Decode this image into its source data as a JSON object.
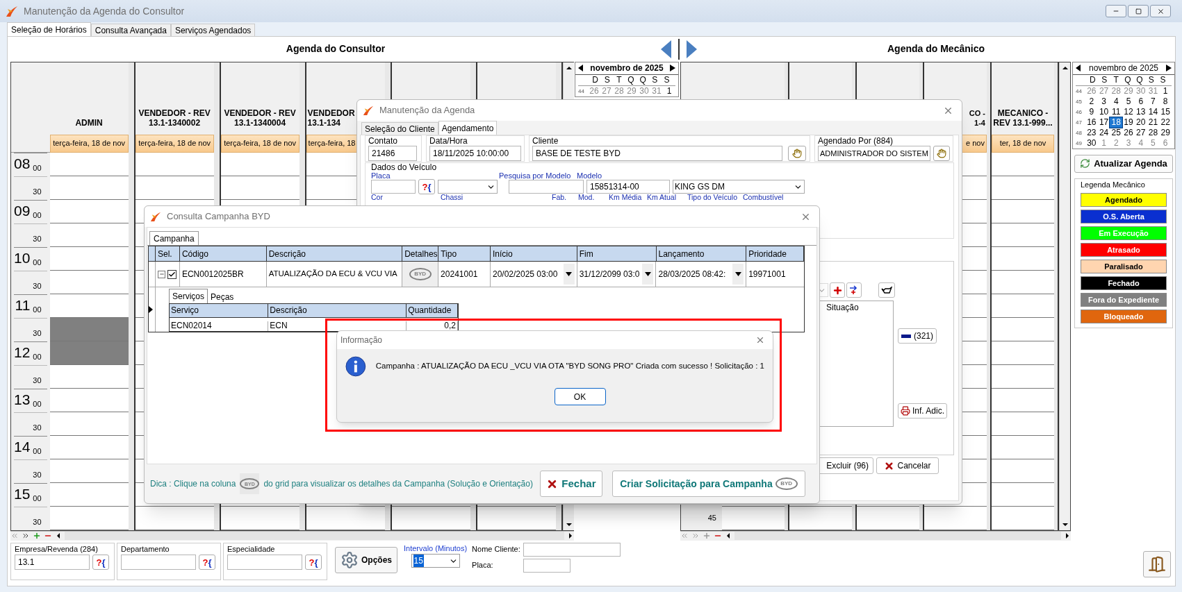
{
  "window": {
    "title": "Manutenção da Agenda do Consultor"
  },
  "tabs": [
    {
      "label": "Seleção de Horários",
      "selected": true
    },
    {
      "label": "Consulta Avançada",
      "selected": false
    },
    {
      "label": "Serviços Agendados",
      "selected": false
    }
  ],
  "consultor": {
    "title": "Agenda do Consultor",
    "time_rows": [
      {
        "hour": "08",
        "minute": "00"
      },
      {
        "minute": "30"
      },
      {
        "hour": "09",
        "minute": "00"
      },
      {
        "minute": "30"
      },
      {
        "hour": "10",
        "minute": "00"
      },
      {
        "minute": "30"
      },
      {
        "hour": "11",
        "minute": "00"
      },
      {
        "minute": "30"
      },
      {
        "hour": "12",
        "minute": "00"
      },
      {
        "minute": "30"
      },
      {
        "hour": "13",
        "minute": "00"
      },
      {
        "minute": "30"
      },
      {
        "hour": "14",
        "minute": "00"
      },
      {
        "minute": "30"
      },
      {
        "hour": "15",
        "minute": "00"
      },
      {
        "minute": "30"
      }
    ],
    "columns": [
      {
        "kind": "full",
        "name_lines": [
          "ADMIN"
        ],
        "date": "terça-feira, 18 de nov",
        "slots": [
          {
            "kind": "free"
          },
          {
            "kind": "free"
          },
          {
            "kind": "free"
          },
          {
            "kind": "free"
          },
          {
            "kind": "free"
          },
          {
            "kind": "free"
          },
          {
            "kind": "free"
          },
          {
            "kind": "blocked"
          },
          {
            "kind": "blocked"
          },
          {
            "kind": "free"
          },
          {
            "kind": "free"
          },
          {
            "kind": "free"
          },
          {
            "kind": "free"
          },
          {
            "kind": "free"
          },
          {
            "kind": "free"
          },
          {
            "kind": "free"
          }
        ]
      },
      {
        "kind": "full",
        "name_lines": [
          "VENDEDOR - REV",
          "13.1-1340002"
        ],
        "date": "terça-feira, 18 de nov"
      },
      {
        "kind": "full",
        "name_lines": [
          "VENDEDOR - REV",
          "13.1-1340004"
        ],
        "date": "terça-feira, 18 de nov"
      },
      {
        "kind": "cut_right",
        "name_lines": [
          "VENDEDOR",
          "13.1-134"
        ],
        "date": "terça-feira, 18"
      },
      {
        "kind": "plain"
      },
      {
        "kind": "plain"
      }
    ],
    "calendar": {
      "month": "novembro de 2025",
      "weekdays": [
        "D",
        "S",
        "T",
        "Q",
        "Q",
        "S",
        "S"
      ],
      "weeks": [
        {
          "number": "44",
          "days": [
            {
              "day": "26",
              "muted": true,
              "selected": false
            },
            {
              "day": "27",
              "muted": true,
              "selected": false
            },
            {
              "day": "28",
              "muted": true,
              "selected": false
            },
            {
              "day": "29",
              "muted": true,
              "selected": false
            },
            {
              "day": "30",
              "muted": true,
              "selected": false
            },
            {
              "day": "31",
              "muted": true,
              "selected": false
            },
            {
              "day": "1",
              "muted": false,
              "selected": false
            }
          ]
        }
      ]
    }
  },
  "mecanico": {
    "title": "Agenda do Mecânico",
    "last_row_label": "45",
    "columns": [
      {
        "kind": "plain"
      },
      {
        "kind": "plain"
      },
      {
        "kind": "plain"
      },
      {
        "kind": "cut_left",
        "name_lines": [
          "CO -",
          "1-4"
        ],
        "date": "e nov"
      },
      {
        "kind": "full",
        "name_lines": [
          "MECANICO -",
          "REV 13.1-999..."
        ],
        "date": "ter, 18 de nov"
      }
    ]
  },
  "sidebar": {
    "calendar": {
      "month": "novembro de 2025",
      "weekdays": [
        "D",
        "S",
        "T",
        "Q",
        "Q",
        "S",
        "S"
      ],
      "weeks": [
        {
          "number": "44",
          "days": [
            {
              "day": "26",
              "muted": true,
              "selected": false
            },
            {
              "day": "27",
              "muted": true,
              "selected": false
            },
            {
              "day": "28",
              "muted": true,
              "selected": false
            },
            {
              "day": "29",
              "muted": true,
              "selected": false
            },
            {
              "day": "30",
              "muted": true,
              "selected": false
            },
            {
              "day": "31",
              "muted": true,
              "selected": false
            },
            {
              "day": "1",
              "muted": false,
              "selected": false
            }
          ]
        },
        {
          "number": "45",
          "days": [
            {
              "day": "2",
              "muted": false,
              "selected": false
            },
            {
              "day": "3",
              "muted": false,
              "selected": false
            },
            {
              "day": "4",
              "muted": false,
              "selected": false
            },
            {
              "day": "5",
              "muted": false,
              "selected": false
            },
            {
              "day": "6",
              "muted": false,
              "selected": false
            },
            {
              "day": "7",
              "muted": false,
              "selected": false
            },
            {
              "day": "8",
              "muted": false,
              "selected": false
            }
          ]
        },
        {
          "number": "46",
          "days": [
            {
              "day": "9",
              "muted": false,
              "selected": false
            },
            {
              "day": "10",
              "muted": false,
              "selected": false
            },
            {
              "day": "11",
              "muted": false,
              "selected": false
            },
            {
              "day": "12",
              "muted": false,
              "selected": false
            },
            {
              "day": "13",
              "muted": false,
              "selected": false
            },
            {
              "day": "14",
              "muted": false,
              "selected": false
            },
            {
              "day": "15",
              "muted": false,
              "selected": false
            }
          ]
        },
        {
          "number": "47",
          "days": [
            {
              "day": "16",
              "muted": false,
              "selected": false
            },
            {
              "day": "17",
              "muted": false,
              "selected": false
            },
            {
              "day": "18",
              "muted": false,
              "selected": true
            },
            {
              "day": "19",
              "muted": false,
              "selected": false
            },
            {
              "day": "20",
              "muted": false,
              "selected": false
            },
            {
              "day": "21",
              "muted": false,
              "selected": false
            },
            {
              "day": "22",
              "muted": false,
              "selected": false
            }
          ]
        },
        {
          "number": "48",
          "days": [
            {
              "day": "23",
              "muted": false,
              "selected": false
            },
            {
              "day": "24",
              "muted": false,
              "selected": false
            },
            {
              "day": "25",
              "muted": false,
              "selected": false
            },
            {
              "day": "26",
              "muted": false,
              "selected": false
            },
            {
              "day": "27",
              "muted": false,
              "selected": false
            },
            {
              "day": "28",
              "muted": false,
              "selected": false
            },
            {
              "day": "29",
              "muted": false,
              "selected": false
            }
          ]
        },
        {
          "number": "49",
          "days": [
            {
              "day": "30",
              "muted": false,
              "selected": false
            },
            {
              "day": "1",
              "muted": true,
              "selected": false
            },
            {
              "day": "2",
              "muted": true,
              "selected": false
            },
            {
              "day": "3",
              "muted": true,
              "selected": false
            },
            {
              "day": "4",
              "muted": true,
              "selected": false
            },
            {
              "day": "5",
              "muted": true,
              "selected": false
            },
            {
              "day": "6",
              "muted": true,
              "selected": false
            }
          ]
        }
      ]
    },
    "refresh_button": "Atualizar Agenda",
    "legend": {
      "title": "Legenda Mecânico",
      "items": [
        {
          "label": "Agendado",
          "color": "#ffff00"
        },
        {
          "label": "O.S. Aberta",
          "color": "#0a2fd0"
        },
        {
          "label": "Em Execução",
          "color": "#00ff00"
        },
        {
          "label": "Atrasado",
          "color": "#ff0000"
        },
        {
          "label": "Paralisado",
          "color": "#ffd5b0"
        },
        {
          "label": "Fechado",
          "color": "#000000"
        },
        {
          "label": "Fora do Expediente",
          "color": "#808080"
        },
        {
          "label": "Bloqueado",
          "color": "#e0660e"
        }
      ]
    }
  },
  "filters": [
    {
      "label": "Empresa/Revenda (284)",
      "value": "13.1",
      "lookup": "?{"
    },
    {
      "label": "Departamento",
      "lookup": "?{"
    },
    {
      "label": "Especialidade",
      "lookup": "?{"
    }
  ],
  "options_button": "Opções",
  "interval": {
    "label": "Intervalo (Minutos)",
    "value": "15"
  },
  "client_name": {
    "label": "Nome Cliente:"
  },
  "plate": {
    "label": "Placa:"
  },
  "appointment_dialog": {
    "title": "Manutenção da Agenda",
    "tabs": [
      {
        "label": "Seleção do Cliente",
        "selected": false
      },
      {
        "label": "Agendamento",
        "selected": true
      }
    ],
    "contact": {
      "label": "Contato",
      "value": "21486"
    },
    "datetime": {
      "label": "Data/Hora",
      "value": "18/11/2025 10:00:00"
    },
    "client": {
      "label": "Cliente",
      "value": "BASE DE TESTE BYD"
    },
    "scheduled_by": {
      "label": "Agendado Por (884)",
      "value": "ADMINISTRADOR DO SISTEM"
    },
    "vehicle": {
      "title": "Dados do Veículo",
      "plate_label": "Placa",
      "lookup": "?{",
      "model_search_label": "Pesquisa por Modelo",
      "model_label": "Modelo",
      "model_code": "15851314-00",
      "model_name": "KING GS DM",
      "labels": [
        "Cor",
        "Chassi",
        "Fab.",
        "Mod.",
        "Km Média",
        "Km Atual",
        "Tipo do Veículo",
        "Combustível"
      ]
    },
    "situation_header": "Situação",
    "count_button": "(321)",
    "info_button": "Inf. Adic.",
    "delete_button": "Excluir (96)",
    "cancel_button": "Cancelar"
  },
  "campaign_dialog": {
    "title": "Consulta Campanha BYD",
    "tab": "Campanha",
    "columns": [
      "Sel.",
      "Código",
      "Descrição",
      "Detalhes",
      "Tipo",
      "Início",
      "Fim",
      "Lançamento",
      "Prioridade"
    ],
    "rows": [
      {
        "expanded": true,
        "checked": true,
        "code": "ECN0012025BR",
        "description": "ATUALIZAÇÃO DA ECU & VCU VIA",
        "details_logo": "BYD",
        "type": "20241001",
        "start": "20/02/2025 03:00",
        "end": "31/12/2099 03:0",
        "launch": "28/03/2025 08:42:",
        "priority": "19971001",
        "detail_tabs": [
          {
            "label": "Serviços",
            "selected": true
          },
          {
            "label": "Peças",
            "selected": false
          }
        ],
        "detail_columns": [
          "Serviço",
          "Descrição",
          "Quantidade"
        ],
        "detail_rows": [
          [
            "ECN02014",
            "ECN",
            "0,2"
          ]
        ]
      }
    ],
    "hint": {
      "before": "Dica : Clique na coluna",
      "logo": "BYD",
      "after": "do grid para visualizar os detalhes da Campanha (Solução e Orientação)"
    },
    "close_button": "Fechar",
    "create_button": {
      "label": "Criar Solicitação para Campanha",
      "logo": "BYD"
    }
  },
  "info_dialog": {
    "title": "Informação",
    "message": "Campanha : ATUALIZAÇÃO DA ECU _VCU VIA OTA \"BYD SONG PRO\" Criada com sucesso ! Solicitação : 1",
    "ok": "OK"
  }
}
